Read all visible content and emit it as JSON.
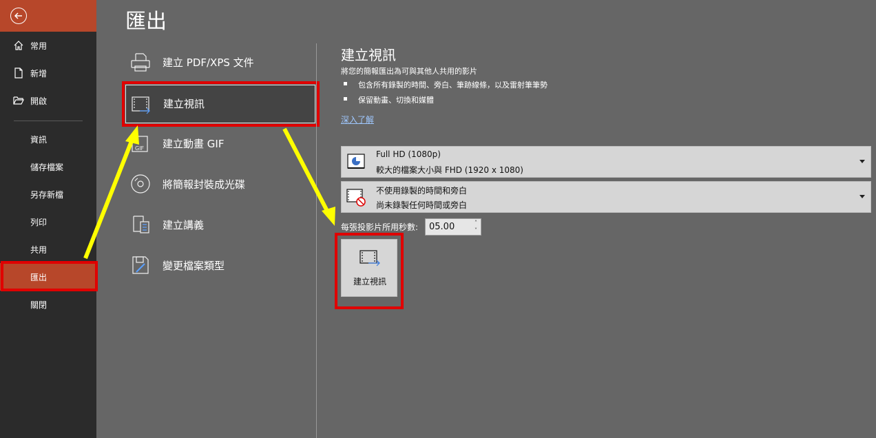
{
  "nav": {
    "items": [
      {
        "label": "常用",
        "icon": "home-icon"
      },
      {
        "label": "新增",
        "icon": "new-document-icon"
      },
      {
        "label": "開啟",
        "icon": "folder-open-icon"
      }
    ],
    "sub_items": [
      {
        "label": "資訊"
      },
      {
        "label": "儲存檔案"
      },
      {
        "label": "另存新檔"
      },
      {
        "label": "列印"
      },
      {
        "label": "共用"
      },
      {
        "label": "匯出"
      },
      {
        "label": "關閉"
      }
    ],
    "active": "匯出",
    "accent": "#b7472a"
  },
  "page_title": "匯出",
  "options": [
    {
      "label": "建立 PDF/XPS 文件",
      "icon": "pdf-printer-icon"
    },
    {
      "label": "建立視訊",
      "icon": "video-icon"
    },
    {
      "label": "建立動畫 GIF",
      "icon": "gif-icon"
    },
    {
      "label": "將簡報封裝成光碟",
      "icon": "cd-icon"
    },
    {
      "label": "建立講義",
      "icon": "handout-icon"
    },
    {
      "label": "變更檔案類型",
      "icon": "change-filetype-icon"
    }
  ],
  "right_pane": {
    "title": "建立視訊",
    "description": "將您的簡報匯出為可與其他人共用的影片",
    "bullets": [
      "包含所有錄製的時間、旁白、筆跡線條，以及雷射筆筆勢",
      "保留動畫、切換和媒體"
    ],
    "link": "深入了解",
    "quality": {
      "line1": "Full HD (1080p)",
      "line2": "較大的檔案大小與 FHD (1920 x 1080)"
    },
    "timing": {
      "line1": "不使用錄製的時間和旁白",
      "line2": "尚未錄製任何時間或旁白"
    },
    "seconds_label": "每張投影片所用秒數:",
    "seconds_value": "05.00",
    "create_button": "建立視訊"
  },
  "colors": {
    "highlight": "#e00000",
    "arrow": "#ffff00",
    "link": "#9fc8ff"
  }
}
